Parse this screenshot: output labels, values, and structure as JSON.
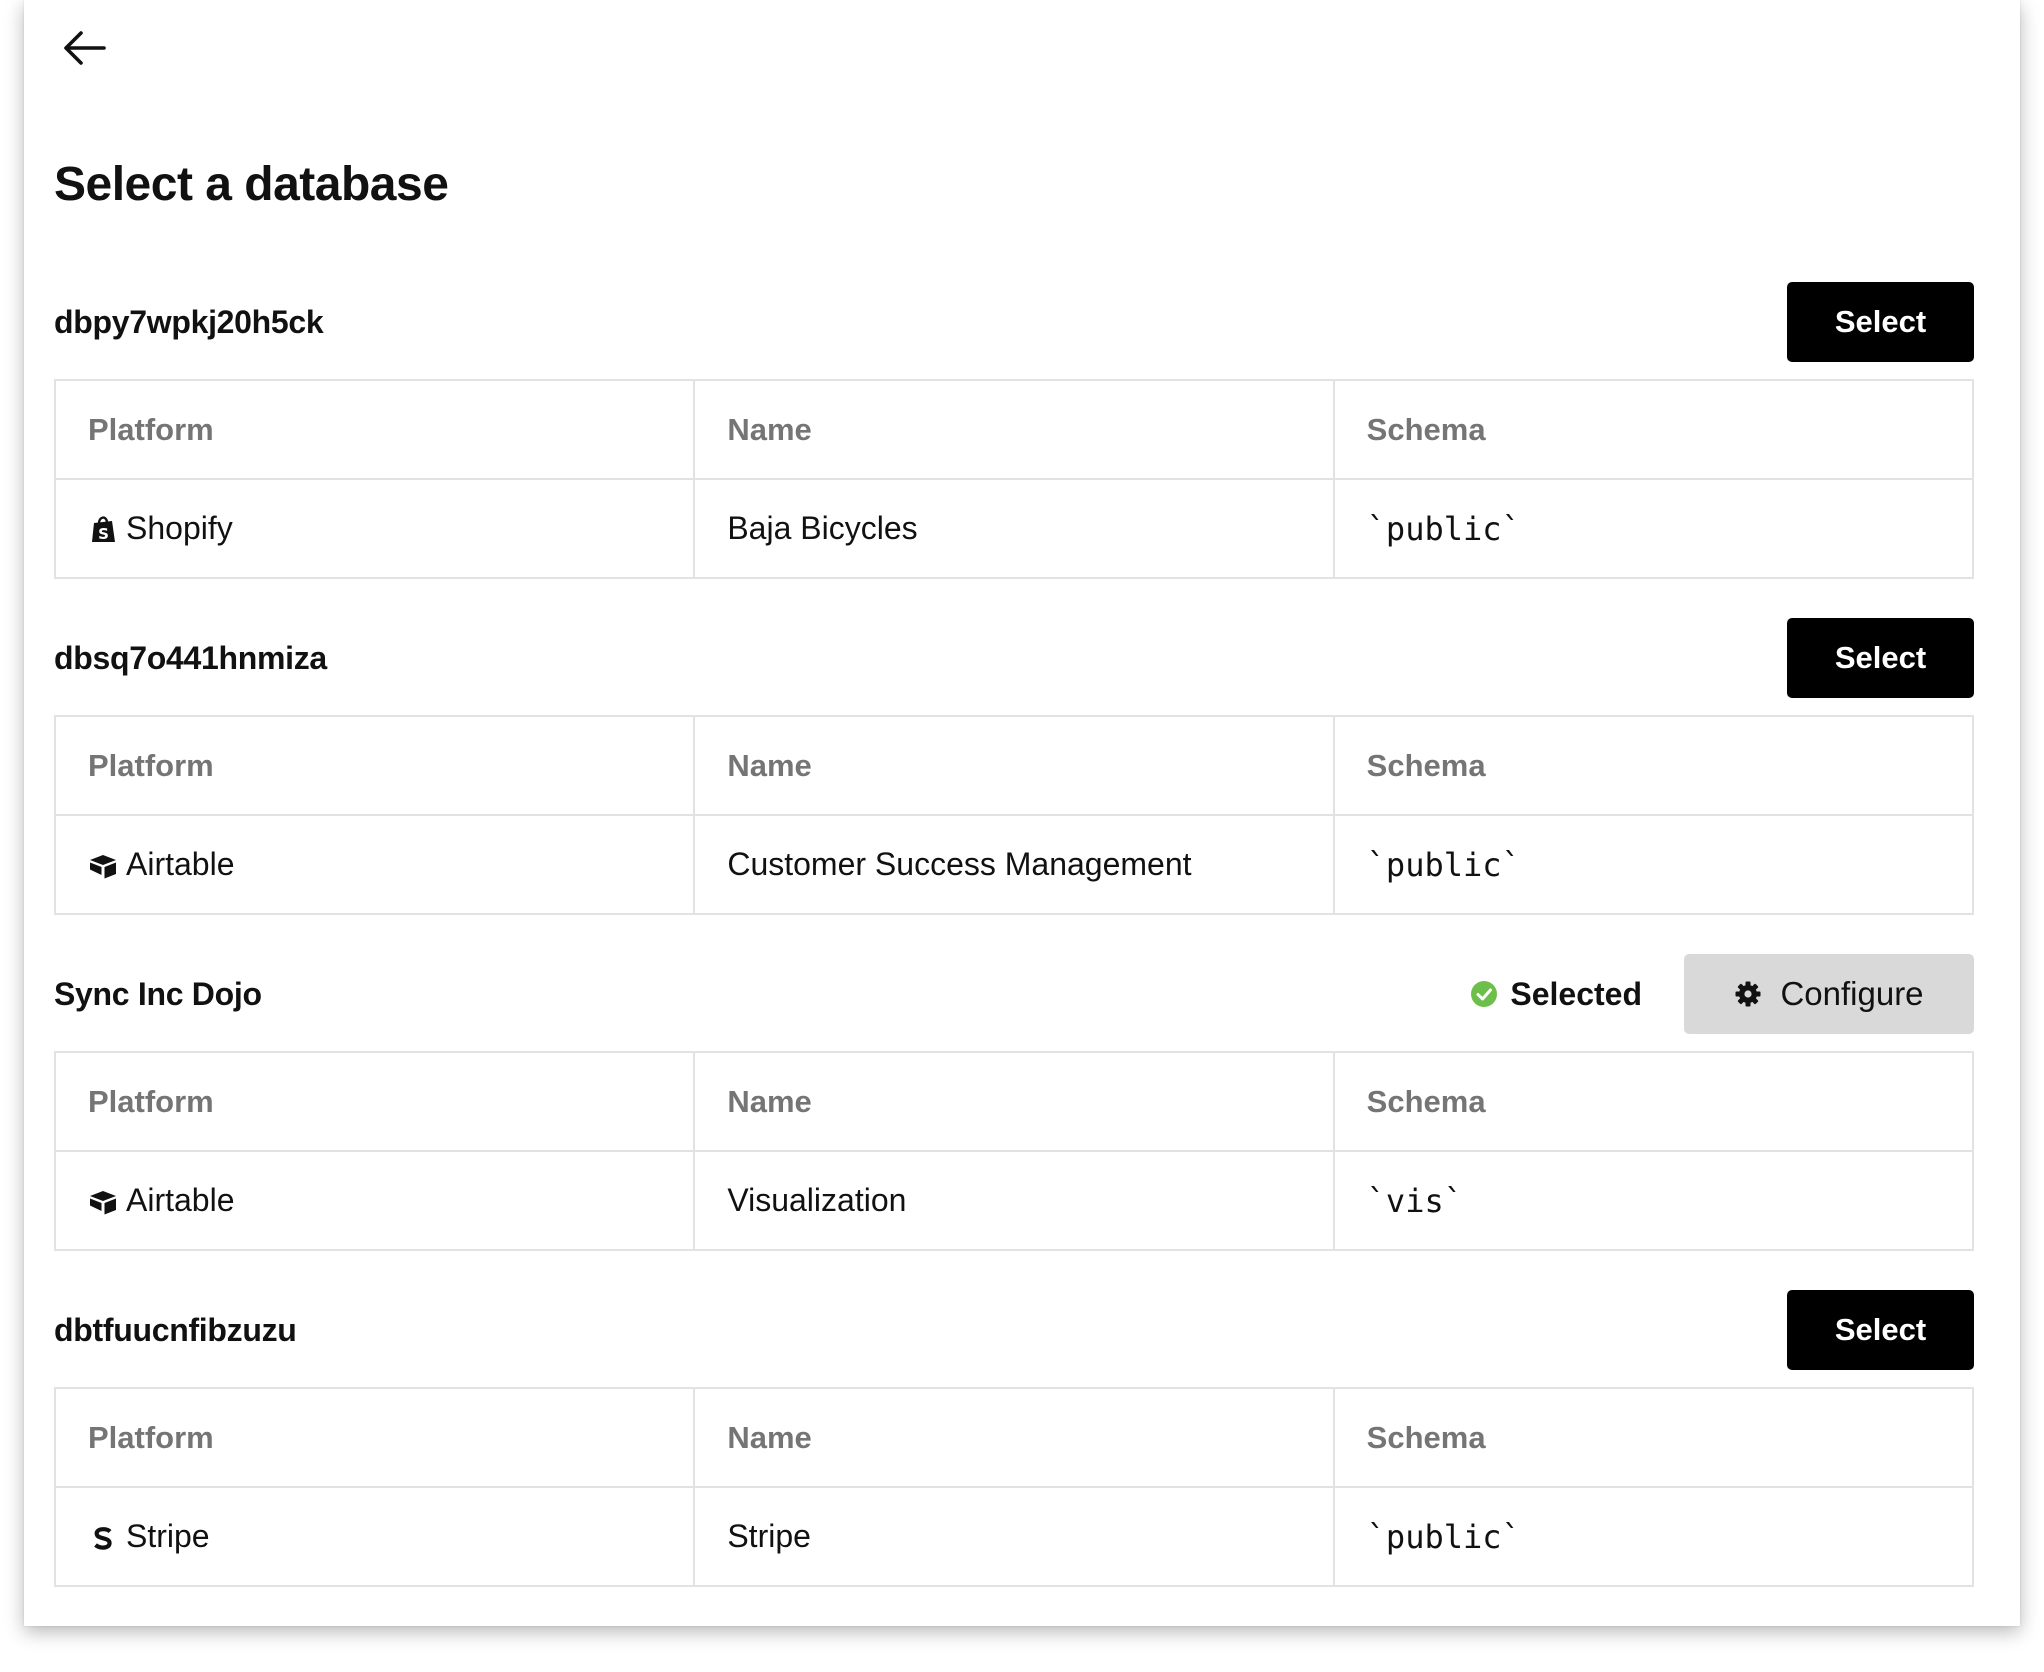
{
  "page": {
    "title": "Select a database"
  },
  "table_headers": {
    "platform": "Platform",
    "name": "Name",
    "schema": "Schema"
  },
  "databases": [
    {
      "id": "dbpy7wpkj20h5ck",
      "action_label": "Select",
      "row": {
        "platform": "Shopify",
        "platform_icon": "shopify-icon",
        "name": "Baja Bicycles",
        "schema": "`public`"
      }
    },
    {
      "id": "dbsq7o441hnmiza",
      "action_label": "Select",
      "row": {
        "platform": "Airtable",
        "platform_icon": "airtable-icon",
        "name": "Customer Success Management",
        "schema": "`public`"
      }
    },
    {
      "id": "Sync Inc Dojo",
      "status_label": "Selected",
      "action_label": "Configure",
      "row": {
        "platform": "Airtable",
        "platform_icon": "airtable-icon",
        "name": "Visualization",
        "schema": "`vis`"
      }
    },
    {
      "id": "dbtfuucnfibzuzu",
      "action_label": "Select",
      "row": {
        "platform": "Stripe",
        "platform_icon": "stripe-icon",
        "name": "Stripe",
        "schema": "`public`"
      }
    }
  ],
  "colors": {
    "select_button_bg": "#000000",
    "configure_button_bg": "#d9d9d9",
    "schema_text": "#8e1a8e",
    "selected_check": "#6cc04a",
    "header_text": "#757575"
  }
}
